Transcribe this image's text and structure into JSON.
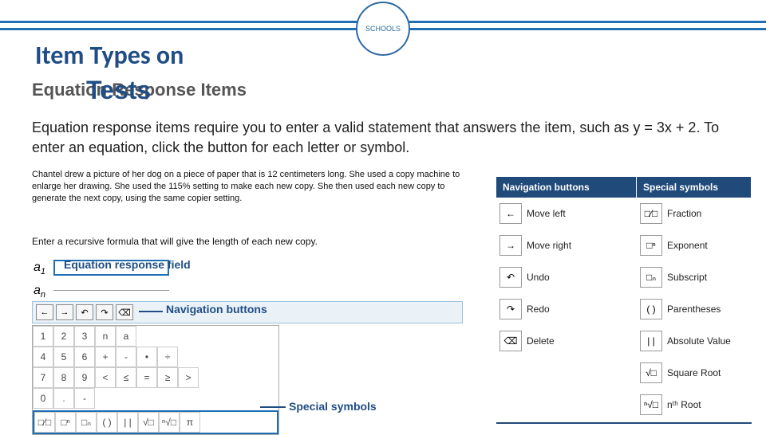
{
  "title_main": "Item Types on",
  "title_tests": "Tests",
  "subtitle_behind": "Equation Response Items",
  "intro": "Equation response items require you to enter a valid statement that answers the item, such as y = 3x + 2.  To enter an equation, click the button for each letter or symbol.",
  "problem": "Chantel drew a picture of her dog on a piece of paper that is 12 centimeters long. She used a copy machine to enlarge her drawing. She used the 115% setting to make each new copy. She then used each new copy to generate the next copy, using the same copier setting.",
  "enter_line": "Enter a recursive formula that will give the length of each new copy.",
  "a1_label": "a",
  "a1_sub": "1",
  "an_label": "a",
  "an_sub": "n",
  "equation_field_label": "Equation response field",
  "nav_buttons_label": "Navigation buttons",
  "special_symbols_label": "Special symbols",
  "nav_icons": [
    "←",
    "→",
    "↶",
    "↷",
    "⌫"
  ],
  "keypad_rows": [
    [
      "1",
      "2",
      "3",
      "n",
      "a"
    ],
    [
      "4",
      "5",
      "6",
      "+",
      "-",
      "•",
      "÷"
    ],
    [
      "7",
      "8",
      "9",
      "<",
      "≤",
      "=",
      "≥",
      ">"
    ],
    [
      "0",
      ".",
      "-"
    ]
  ],
  "sym_row": [
    "□⁄□",
    "□ⁿ",
    "□ₙ",
    "( )",
    "| |",
    "√□",
    "ⁿ√□",
    "π"
  ],
  "table": {
    "hdr_nav": "Navigation buttons",
    "hdr_sym": "Special symbols",
    "rows": [
      {
        "nav_icon": "←",
        "nav_label": "Move left",
        "sym_icon": "□⁄□",
        "sym_label": "Fraction"
      },
      {
        "nav_icon": "→",
        "nav_label": "Move right",
        "sym_icon": "□ⁿ",
        "sym_label": "Exponent"
      },
      {
        "nav_icon": "↶",
        "nav_label": "Undo",
        "sym_icon": "□ₙ",
        "sym_label": "Subscript"
      },
      {
        "nav_icon": "↷",
        "nav_label": "Redo",
        "sym_icon": "( )",
        "sym_label": "Parentheses"
      },
      {
        "nav_icon": "⌫",
        "nav_label": "Delete",
        "sym_icon": "| |",
        "sym_label": "Absolute Value"
      },
      {
        "nav_icon": "",
        "nav_label": "",
        "sym_icon": "√□",
        "sym_label": "Square Root"
      },
      {
        "nav_icon": "",
        "nav_label": "",
        "sym_icon": "ⁿ√□",
        "sym_label": "nᵗʰ Root"
      }
    ]
  },
  "logo_text": "SCHOOLS"
}
